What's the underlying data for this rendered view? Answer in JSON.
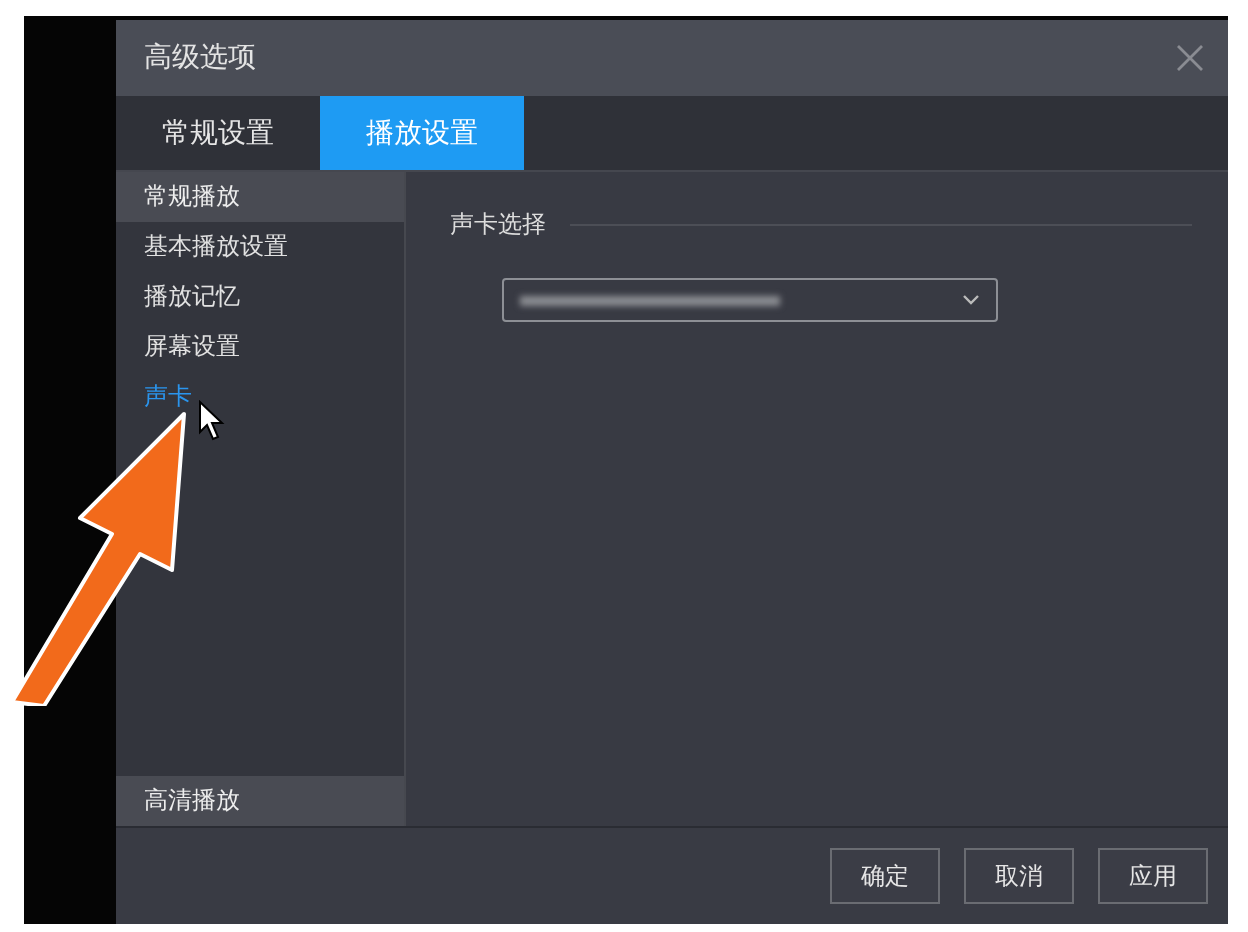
{
  "window": {
    "title": "高级选项"
  },
  "tabs": [
    {
      "label": "常规设置",
      "selected": false
    },
    {
      "label": "播放设置",
      "selected": true
    }
  ],
  "sidebar": {
    "sections": [
      {
        "label": "常规播放",
        "items": [
          {
            "label": "基本播放设置",
            "selected": false
          },
          {
            "label": "播放记忆",
            "selected": false
          },
          {
            "label": "屏幕设置",
            "selected": false
          },
          {
            "label": "声卡",
            "selected": true
          }
        ]
      },
      {
        "label": "高清播放"
      }
    ]
  },
  "content": {
    "group_title": "声卡选择",
    "dropdown": {
      "expanded": false
    }
  },
  "buttons": [
    {
      "label": "确定"
    },
    {
      "label": "取消"
    },
    {
      "label": "应用"
    }
  ]
}
